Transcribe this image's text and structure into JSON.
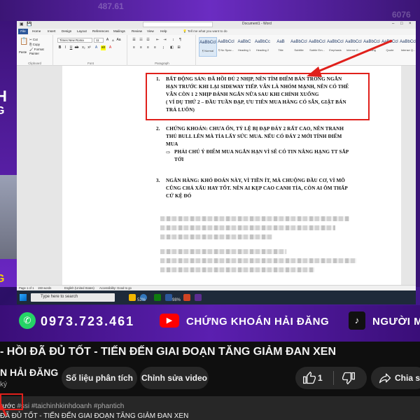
{
  "overlay": {
    "bg_number_left": "487.61",
    "bg_number_right": "6076",
    "strip_text_1": "H",
    "strip_text_2": "G",
    "strip_text_3": "G"
  },
  "word": {
    "doc_title": "Document1 - Word",
    "tell_me": "Tell me what you want to do",
    "tabs": [
      "File",
      "Home",
      "Insert",
      "Design",
      "Layout",
      "References",
      "Mailings",
      "Review",
      "View",
      "Help"
    ],
    "clipboard": {
      "paste": "Paste",
      "cut": "Cut",
      "copy": "Copy",
      "format_painter": "Format Painter",
      "label": "Clipboard"
    },
    "font": {
      "name": "Times New Roma",
      "size": "11",
      "label": "Font"
    },
    "paragraph_label": "Paragraph",
    "styles": [
      {
        "sample": "AaBbCcI",
        "name": "¶ Normal"
      },
      {
        "sample": "AaBbCcI",
        "name": "¶ No Spac..."
      },
      {
        "sample": "AaBbC",
        "name": "Heading 1"
      },
      {
        "sample": "AaBbCc",
        "name": "Heading 2"
      },
      {
        "sample": "AaB",
        "name": "Title"
      },
      {
        "sample": "AaBbCcI",
        "name": "Subtitle"
      },
      {
        "sample": "AaBbCcI",
        "name": "Subtle Em..."
      },
      {
        "sample": "AaBbCcI",
        "name": "Emphasis"
      },
      {
        "sample": "AaBbCcI",
        "name": "Intense E..."
      },
      {
        "sample": "AaBbCcI",
        "name": "Strong"
      },
      {
        "sample": "AaBbCcI",
        "name": "Quote"
      },
      {
        "sample": "AaBbCcI",
        "name": "Intense Q..."
      }
    ],
    "doc": {
      "item1_num": "1.",
      "item1_lines": [
        "BẤT ĐỘNG SẢN: ĐÃ HỒI ĐỦ 2 NHỊP, NÊN TÌM ĐIỂM BÁN TRONG NGẮN",
        "HẠN TRƯỚC KHI LẠI SIDEWAY TIẾP. VẪN LÀ NHÓM MẠNH, NÊN CÓ THỂ",
        "VẪN CÒN 1 2 NHỊP ĐÁNH NGẮN NỮA SAU KHI CHỈNH XUỐNG",
        "( VÍ DỤ THỨ 2 – ĐẦU TUẦN ĐẠP, ƯU TIÊN MUA HÀNG CÓ SẴN, GIẬT BÁN",
        "TRẢ LUÔN)"
      ],
      "item2_num": "2.",
      "item2_lines": [
        "CHỨNG KHOÁN: CHƯA ỔN, TỶ LỆ BỊ ĐẠP ĐÁY 2 RẤT CAO, NÊN TRANH",
        "THỦ BULL LÊN MÀ TỈA LẤY SỨC MUA. NẾU CÓ ĐÁY 2 MỚI TÍNH ĐIỂM",
        "MUA"
      ],
      "item2_arrow": "⇨",
      "item2_sub": [
        "PHẢI CHÚ Ý ĐIỂM MUA NGẮN HẠN VÌ SẼ CÓ TIN NÂNG HẠNG TT SẮP",
        "TỚI"
      ],
      "item3_num": "3.",
      "item3_lines": [
        "NGÂN HÀNG: KHÓ ĐOÁN NÀY, VÌ TIỀN ÍT, MÀ CHUỘNG ĐẦU CƠ, VÌ MÔ",
        "CŨNG CHẢ XẤU HAY TỐT. NÊN AI KẸP CAO CANH TỈA, CÒN AI ÔM THẤP",
        "CỨ KỆ ĐÓ"
      ]
    },
    "status": {
      "page": "Page 1 of 1",
      "words": "193 words",
      "lang": "English (United States)",
      "access": "Accessibility: Good to go"
    }
  },
  "taskbar": {
    "search_placeholder": "Type here to search",
    "badge1": "52%",
    "badge2": "98%"
  },
  "banner": {
    "phone": "0973.723.461",
    "channel": "CHỨNG KHOÁN HẢI ĐĂNG",
    "tiktok": "NGƯỜI M"
  },
  "youtube": {
    "video_title": "- HỒI ĐÃ ĐỦ TỐT - TIẾN ĐẾN GIAI ĐOẠN TĂNG GIẢM ĐAN XEN",
    "channel_name": "N HẢI ĐĂNG",
    "subscribers": "ký",
    "btn_analysis": "Số liệu phân tích",
    "btn_edit": "Chỉnh sửa video",
    "like_count": "1",
    "share_label": "Chia sẻ",
    "desc_prefix": "rước",
    "desc_tags": "#ssi #taichinhkinhdoanh #phantich",
    "desc_line2": "ĐÃ ĐỦ TỐT - TIẾN ĐẾN GIAI ĐOẠN TĂNG GIẢM ĐAN XEN"
  },
  "colors": {
    "accent_red": "#e0201b",
    "word_blue": "#2b579a",
    "yt_bg": "#0f0f0f",
    "pill_bg": "#272727",
    "banner_purple": "#5b1fb0"
  }
}
